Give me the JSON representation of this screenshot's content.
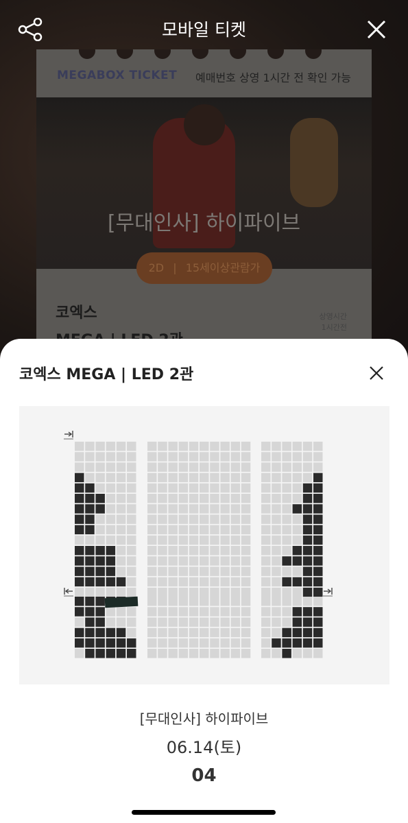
{
  "header": {
    "title": "모바일 티켓",
    "share_icon": "share-icon",
    "close_icon": "close-icon"
  },
  "ticket": {
    "brand": "MEGABOX TICKET",
    "notice": "예매번호 상영 1시간 전 확인 가능",
    "movie_title": "[무대인사] 하이파이브",
    "format": "2D",
    "rating": "15세이상관람가",
    "theater_line1": "코엑스",
    "theater_line2": "MEGA | LED 2관",
    "side_info": [
      "상영시간",
      "1시간전"
    ]
  },
  "sheet": {
    "title": "코엑스 MEGA | LED 2관",
    "close_icon": "close-icon",
    "movie": "[무대인사] 하이파이브",
    "date": "06.14(토)",
    "seat_count": "04"
  },
  "seatmap": {
    "colors": {
      "available": "#d6d6d6",
      "occupied": "#2a2a2a",
      "background": "#f4f4f4",
      "highlight": "#1c2b27"
    },
    "upper_left": [
      "000000",
      "000000",
      "000000",
      "100000",
      "110000",
      "111000",
      "111000",
      "110000",
      "110000",
      "000000",
      "111100",
      "111100",
      "111100",
      "111110",
      "000000"
    ],
    "upper_center": [
      "0000000000",
      "0000000000",
      "0000000000",
      "0000000000",
      "0000000000",
      "0000000000",
      "0000000000",
      "0000000000",
      "0000000000",
      "0000000000",
      "0000000000",
      "0000000000",
      "0000000000",
      "0000000000",
      "0000000000"
    ],
    "upper_right": [
      "000000",
      "000000",
      "000000",
      "000001",
      "000011",
      "000011",
      "000111",
      "000011",
      "000011",
      "000011",
      "000111",
      "001111",
      "000011",
      "001111",
      "000011"
    ],
    "lower_left": [
      "111110",
      "111000",
      "011000",
      "111110",
      "111111",
      "011111"
    ],
    "lower_center": [
      "0000000000",
      "0000000000",
      "0000000000",
      "0000000000",
      "0000000000",
      "0000000000"
    ],
    "lower_right": [
      "000000",
      "000111",
      "000111",
      "001111",
      "011111",
      "001000"
    ]
  }
}
